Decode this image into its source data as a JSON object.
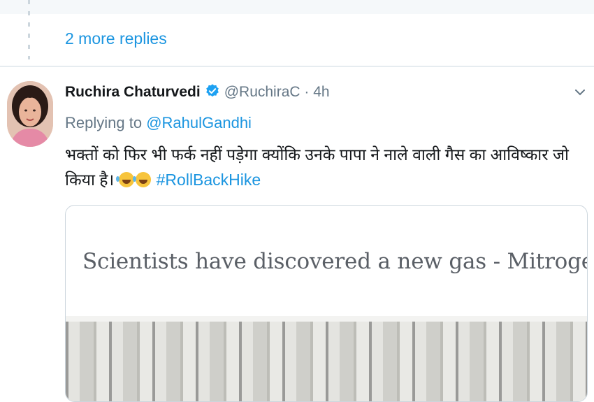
{
  "thread": {
    "more_replies_label": "2 more replies"
  },
  "tweet": {
    "author_name": "Ruchira Chaturvedi",
    "verified": true,
    "handle_and_time": "@RuchiraC · 4h",
    "replying_prefix": "Replying to ",
    "replying_mention": "@RahulGandhi",
    "text_main": "भक्तों को फिर भी फर्क नहीं पड़ेगा क्योंकि उनके पापा ने नाले वाली गैस का आविष्कार जो किया है।",
    "emojis": [
      "rolling-on-floor-laughing",
      "rolling-on-floor-laughing"
    ],
    "hashtag": "#RollBackHike",
    "media": {
      "headline": "Scientists have discovered a new gas - Mitrogen"
    }
  },
  "colors": {
    "link_blue": "#1b95e0",
    "verified_blue": "#1da1f2",
    "muted_gray": "#657786",
    "divider": "#e6ecf0"
  },
  "icons": {
    "verified": "verified-badge-icon",
    "chevron": "chevron-down-icon"
  }
}
